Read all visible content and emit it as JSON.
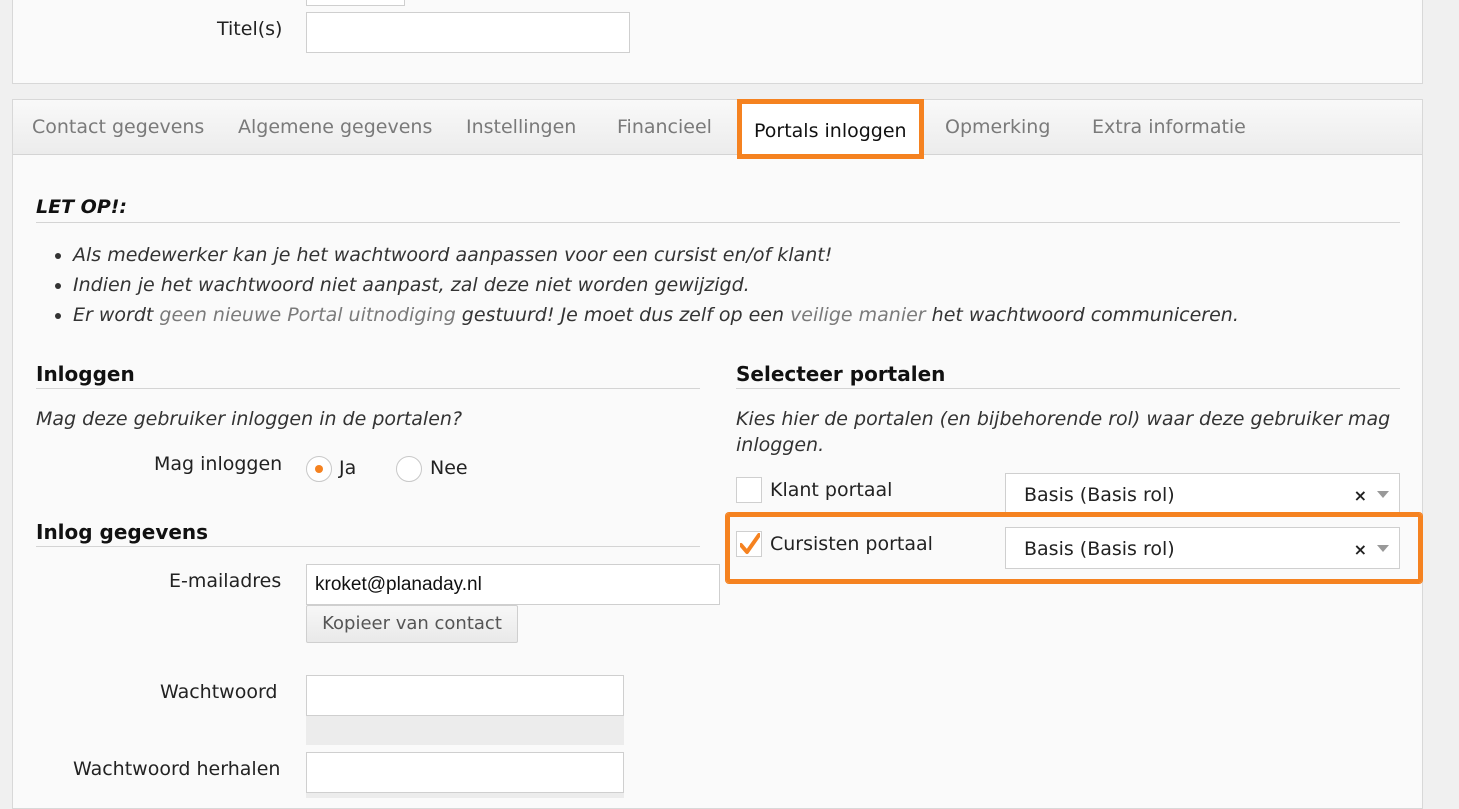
{
  "top_form": {
    "titel_label": "Titel(s)",
    "titel_value": ""
  },
  "tabs": [
    {
      "label": "Contact gegevens",
      "active": false
    },
    {
      "label": "Algemene gegevens",
      "active": false
    },
    {
      "label": "Instellingen",
      "active": false
    },
    {
      "label": "Financieel",
      "active": false
    },
    {
      "label": "Portals inloggen",
      "active": true
    },
    {
      "label": "Opmerking",
      "active": false
    },
    {
      "label": "Extra informatie",
      "active": false
    }
  ],
  "notice": {
    "heading": "LET OP!:",
    "items": [
      {
        "text": "Als medewerker kan je het wachtwoord aanpassen voor een cursist en/of klant!"
      },
      {
        "text": "Indien je het wachtwoord niet aanpast, zal deze niet worden gewijzigd."
      },
      {
        "prefix": "Er wordt ",
        "highlight1": "geen nieuwe Portal uitnodiging",
        "middle": " gestuurd! Je moet dus zelf op een ",
        "highlight2": "veilige manier",
        "suffix": " het wachtwoord communiceren."
      }
    ]
  },
  "login": {
    "heading": "Inloggen",
    "question": "Mag deze gebruiker inloggen in de portalen?",
    "mag_inloggen_label": "Mag inloggen",
    "option_yes": "Ja",
    "option_no": "Nee",
    "selected": "Ja"
  },
  "credentials": {
    "heading": "Inlog gegevens",
    "email_label": "E-mailadres",
    "email_value": "kroket@planaday.nl",
    "copy_button": "Kopieer van contact",
    "password_label": "Wachtwoord",
    "password_value": "",
    "password_repeat_label": "Wachtwoord herhalen",
    "password_repeat_value": ""
  },
  "portals": {
    "heading": "Selecteer portalen",
    "description": "Kies hier de portalen (en bijbehorende rol) waar deze gebruiker mag inloggen.",
    "items": [
      {
        "label": "Klant portaal",
        "checked": false,
        "role": "Basis (Basis rol)",
        "clear": "×"
      },
      {
        "label": "Cursisten portaal",
        "checked": true,
        "role": "Basis (Basis rol)",
        "clear": "×"
      }
    ]
  },
  "colors": {
    "accent": "#f58220",
    "muted_text": "#7a7a7a"
  }
}
